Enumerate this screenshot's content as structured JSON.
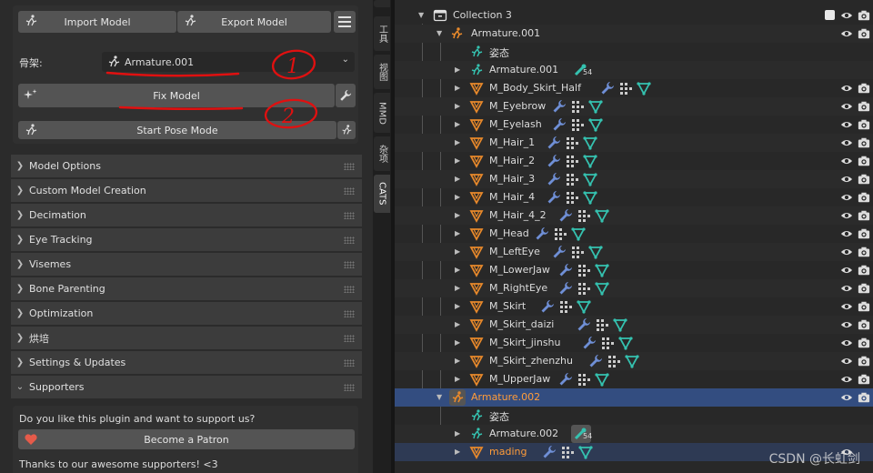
{
  "cats": {
    "import_label": "Import Model",
    "export_label": "Export Model",
    "armature_label": "骨架:",
    "armature_value": "Armature.001",
    "fix_label": "Fix Model",
    "pose_label": "Start Pose Mode",
    "sections": [
      "Model Options",
      "Custom Model Creation",
      "Decimation",
      "Eye Tracking",
      "Visemes",
      "Bone Parenting",
      "Optimization",
      "烘培",
      "Settings & Updates"
    ],
    "supporters_label": "Supporters",
    "supporters_text": "Do you like this plugin and want to support us?",
    "patron_label": "Become a Patron",
    "thanks_text": "Thanks to our awesome supporters! <3"
  },
  "tabs": [
    "工具",
    "视图",
    "MMD",
    "杂项",
    "CATS"
  ],
  "outliner": {
    "collection": "Collection 3",
    "armature1": "Armature.001",
    "pose1": "姿态",
    "armdata1": "Armature.001",
    "armdata1_count": "54",
    "meshes": [
      "M_Body_Skirt_Half",
      "M_Eyebrow",
      "M_Eyelash",
      "M_Hair_1",
      "M_Hair_2",
      "M_Hair_3",
      "M_Hair_4",
      "M_Hair_4_2",
      "M_Head",
      "M_LeftEye",
      "M_LowerJaw",
      "M_RightEye",
      "M_Skirt",
      "M_Skirt_daizi",
      "M_Skirt_jinshu",
      "M_Skirt_zhenzhu",
      "M_UpperJaw"
    ],
    "armature2": "Armature.002",
    "pose2": "姿态",
    "armdata2": "Armature.002",
    "armdata2_count": "54",
    "mesh_last": "mading"
  },
  "annotations": [
    "1",
    "2"
  ],
  "watermark": "CSDN @长虹剑",
  "colors": {
    "selected_row": "#334d80",
    "selected_text": "#ff9c3a",
    "annotation": "#e01010",
    "mesh_icon": "#e8892b",
    "armature_icon": "#35c2b0"
  }
}
